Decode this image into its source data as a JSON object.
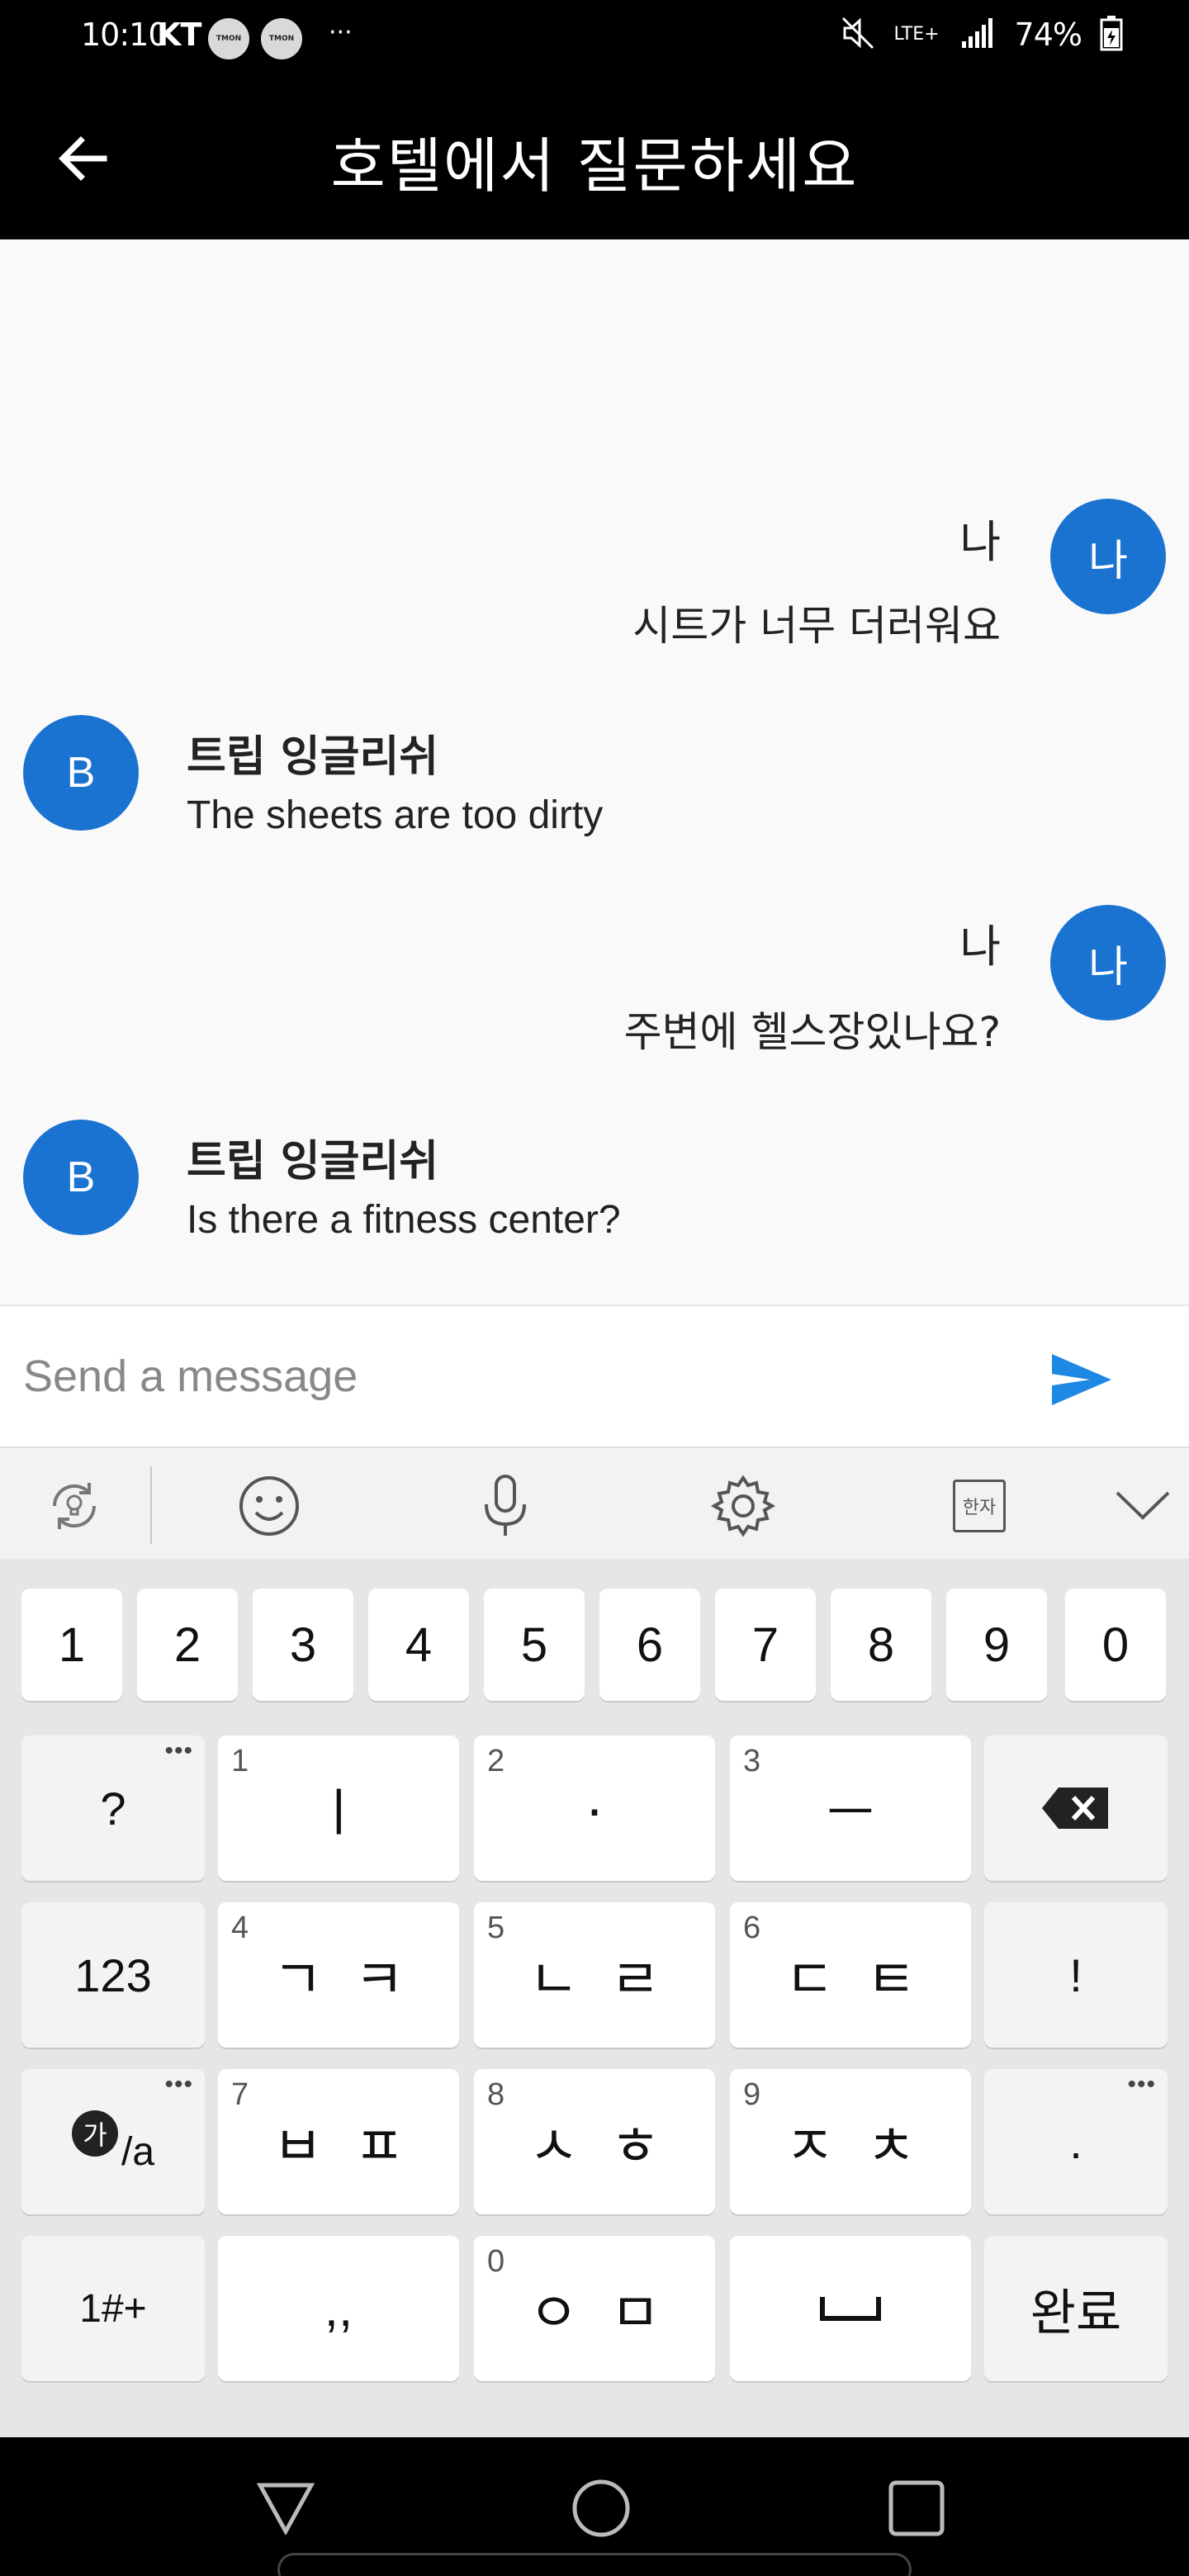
{
  "status_bar": {
    "time": "10:10",
    "carrier": "KT",
    "tmon_label": "TMON",
    "more": "···",
    "network": "LTE+",
    "battery": "74%"
  },
  "app_bar": {
    "title": "호텔에서 질문하세요"
  },
  "messages": [
    {
      "sender": "user",
      "avatar": "나",
      "name": "나",
      "text": "시트가 너무 더러워요"
    },
    {
      "sender": "bot",
      "avatar": "B",
      "name": "트립 잉글리쉬",
      "text": "The sheets are too dirty"
    },
    {
      "sender": "user",
      "avatar": "나",
      "name": "나",
      "text": "주변에 헬스장있나요?"
    },
    {
      "sender": "bot",
      "avatar": "B",
      "name": "트립 잉글리쉬",
      "text": "Is there a fitness center?"
    }
  ],
  "input": {
    "placeholder": "Send a message"
  },
  "keyboard": {
    "toolbar": {
      "hanja_label": "한자"
    },
    "number_row": [
      "1",
      "2",
      "3",
      "4",
      "5",
      "6",
      "7",
      "8",
      "9",
      "0"
    ],
    "rows": {
      "r1": {
        "left": "?",
        "k1_sub": "1",
        "k1": "ㅣ",
        "k2_sub": "2",
        "k2": "·",
        "k3_sub": "3",
        "k3": "ㅡ"
      },
      "r2": {
        "left": "123",
        "k1_sub": "4",
        "k1": "ㄱㅋ",
        "k2_sub": "5",
        "k2": "ㄴㄹ",
        "k3_sub": "6",
        "k3": "ㄷㅌ",
        "right": "!"
      },
      "r3": {
        "left_main": "가",
        "left_sub": "/a",
        "k1_sub": "7",
        "k1": "ㅂㅍ",
        "k2_sub": "8",
        "k2": "ㅅㅎ",
        "k3_sub": "9",
        "k3": "ㅈㅊ",
        "right": "."
      },
      "r4": {
        "left": "1#+",
        "k1": ",,",
        "k2_sub": "0",
        "k2": "ㅇㅁ",
        "right": "완료"
      }
    }
  }
}
